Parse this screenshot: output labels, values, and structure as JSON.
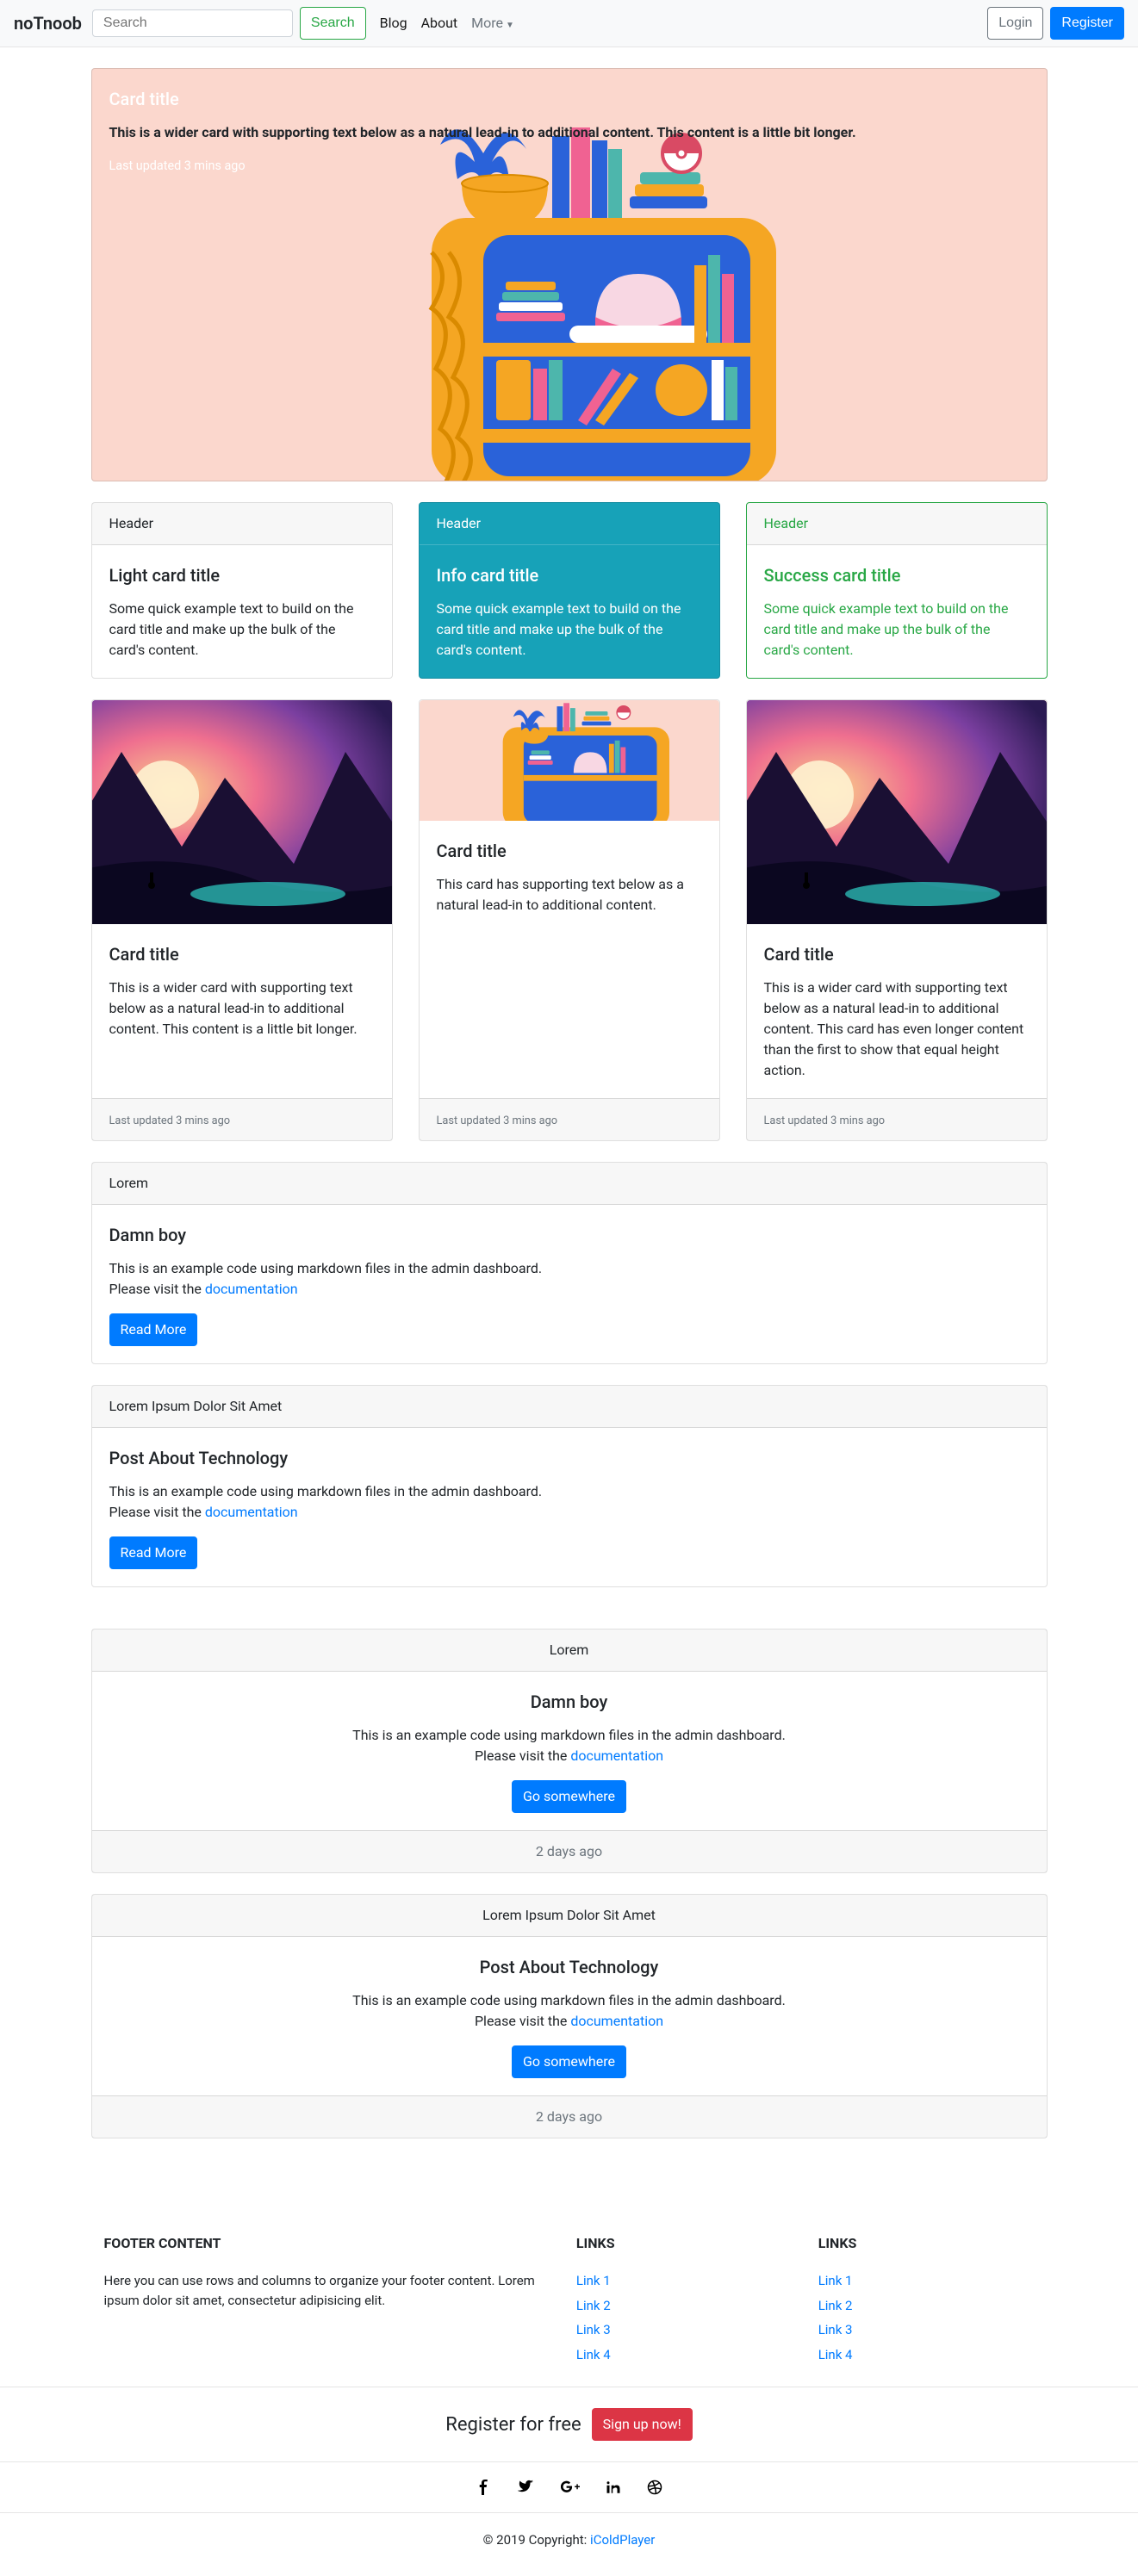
{
  "nav": {
    "brand": "noTnoob",
    "search_placeholder": "Search",
    "search_btn": "Search",
    "links": [
      "Blog",
      "About"
    ],
    "more_label": "More",
    "login": "Login",
    "register": "Register"
  },
  "hero": {
    "title": "Card title",
    "text": "This is a wider card with supporting text below as a natural lead-in to additional content. This content is a little bit longer.",
    "updated": "Last updated 3 mins ago"
  },
  "themed_cards": [
    {
      "header": "Header",
      "title": "Light card title",
      "text": "Some quick example text to build on the card title and make up the bulk of the card's content."
    },
    {
      "header": "Header",
      "title": "Info card title",
      "text": "Some quick example text to build on the card title and make up the bulk of the card's content."
    },
    {
      "header": "Header",
      "title": "Success card title",
      "text": "Some quick example text to build on the card title and make up the bulk of the card's content."
    }
  ],
  "img_cards": {
    "footer_text": "Last updated 3 mins ago",
    "items": [
      {
        "title": "Card title",
        "text": "This is a wider card with supporting text below as a natural lead-in to additional content. This content is a little bit longer."
      },
      {
        "title": "Card title",
        "text": "This card has supporting text below as a natural lead-in to additional content."
      },
      {
        "title": "Card title",
        "text": "This is a wider card with supporting text below as a natural lead-in to additional content. This card has even longer content than the first to show that equal height action."
      }
    ]
  },
  "posts_left": [
    {
      "header": "Lorem",
      "title": "Damn boy",
      "body": "This is an example code using markdown files in the admin dashboard.",
      "visit": "Please visit the ",
      "doc_label": "documentation",
      "btn": "Read More"
    },
    {
      "header": "Lorem Ipsum Dolor Sit Amet",
      "title": "Post About Technology",
      "body": "This is an example code using markdown files in the admin dashboard.",
      "visit": "Please visit the ",
      "doc_label": "documentation",
      "btn": "Read More"
    }
  ],
  "posts_center": [
    {
      "header": "Lorem",
      "title": "Damn boy",
      "body": "This is an example code using markdown files in the admin dashboard.",
      "visit": "Please visit the ",
      "doc_label": "documentation",
      "btn": "Go somewhere",
      "footer": "2 days ago"
    },
    {
      "header": "Lorem Ipsum Dolor Sit Amet",
      "title": "Post About Technology",
      "body": "This is an example code using markdown files in the admin dashboard.",
      "visit": "Please visit the ",
      "doc_label": "documentation",
      "btn": "Go somewhere",
      "footer": "2 days ago"
    }
  ],
  "footer": {
    "content_heading": "Footer Content",
    "content_text": "Here you can use rows and columns to organize your footer content. Lorem ipsum dolor sit amet, consectetur adipisicing elit.",
    "links_heading": "Links",
    "links": [
      "Link 1",
      "Link 2",
      "Link 3",
      "Link 4"
    ],
    "cta_text": "Register for free",
    "cta_btn": "Sign up now!",
    "copyright_prefix": "© 2019 Copyright: ",
    "copyright_link": "iColdPlayer"
  }
}
